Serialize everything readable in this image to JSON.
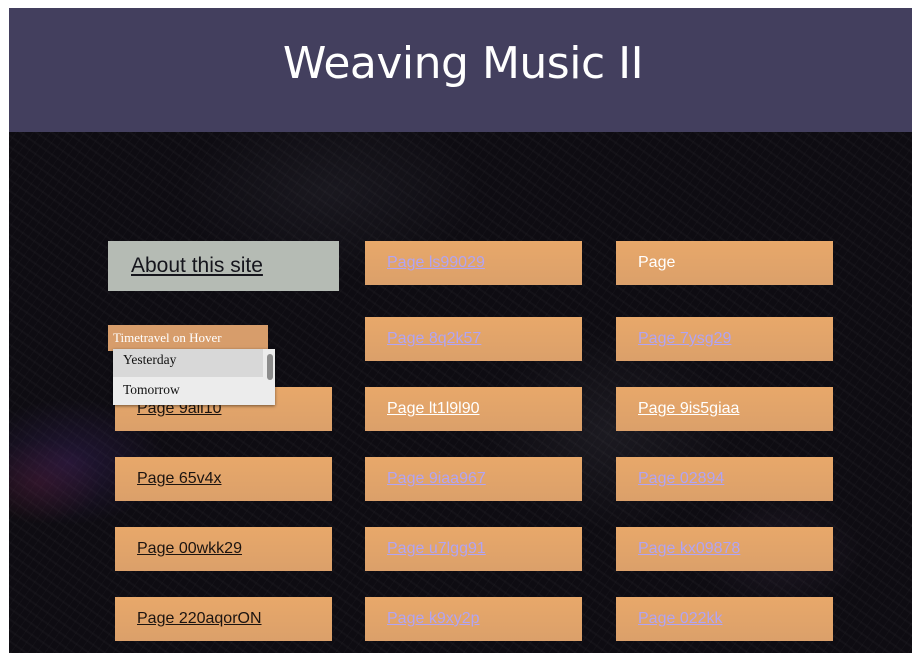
{
  "header": {
    "title": "Weaving Music II"
  },
  "about": {
    "label": "About this site"
  },
  "timetravel": {
    "label": "Timetravel on Hover",
    "options": [
      "Yesterday",
      "Tomorrow"
    ]
  },
  "pages": {
    "c2r1": "Page ls99029",
    "c3r1": "Page",
    "c2r2": "Page 8q2k57",
    "c3r2": "Page 7ysg29",
    "c1r3": "Page 9aii10",
    "c2r3": "Page lt1l9l90",
    "c3r3": "Page 9is5giaa",
    "c1r4": "Page 65v4x",
    "c2r4": "Page 9iaa967",
    "c3r4": "Page 02894",
    "c1r5": "Page 00wkk29",
    "c2r5": "Page u7lgg91",
    "c3r5": "Page kx09878",
    "c1r6": "Page 220aqorON",
    "c2r6": "Page k9xy2p",
    "c3r6": "Page 022kk"
  },
  "colors": {
    "header_bg": "#433f5e",
    "tile_bg": "#e1a56a",
    "link_visited": "#b1a4f4",
    "about_bg": "#b5bbb4"
  }
}
